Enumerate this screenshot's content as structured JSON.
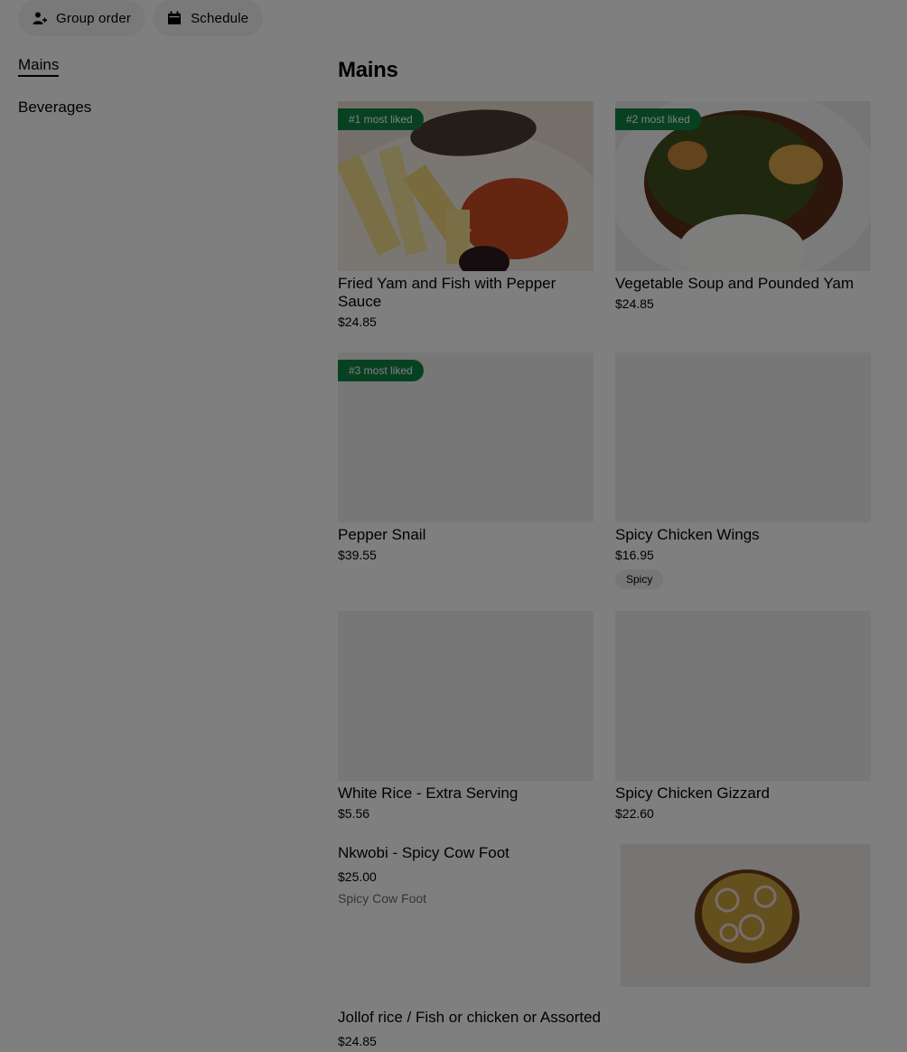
{
  "top_buttons": {
    "group_order": "Group order",
    "schedule": "Schedule"
  },
  "sidebar": {
    "items": [
      {
        "label": "Mains",
        "active": true
      },
      {
        "label": "Beverages",
        "active": false
      }
    ]
  },
  "section": {
    "title": "Mains"
  },
  "items": [
    {
      "name": "Fried Yam and Fish with Pepper Sauce",
      "price": "$24.85",
      "badge": "#1 most liked"
    },
    {
      "name": "Vegetable Soup and Pounded Yam",
      "price": "$24.85",
      "badge": "#2 most liked"
    },
    {
      "name": "Pepper Snail",
      "price": "$39.55",
      "badge": "#3 most liked"
    },
    {
      "name": "Spicy Chicken Wings",
      "price": "$16.95",
      "tag": "Spicy"
    },
    {
      "name": "White Rice - Extra Serving",
      "price": "$5.56"
    },
    {
      "name": "Spicy Chicken Gizzard",
      "price": "$22.60"
    }
  ],
  "wide_items": [
    {
      "name": "Nkwobi - Spicy Cow Foot",
      "price": "$25.00",
      "description": "Spicy Cow Foot"
    },
    {
      "name": "Jollof rice / Fish or chicken or Assorted",
      "price": "$24.85"
    }
  ],
  "colors": {
    "badge": "#0e8345",
    "overlay": "rgba(0,0,0,0.5)"
  }
}
